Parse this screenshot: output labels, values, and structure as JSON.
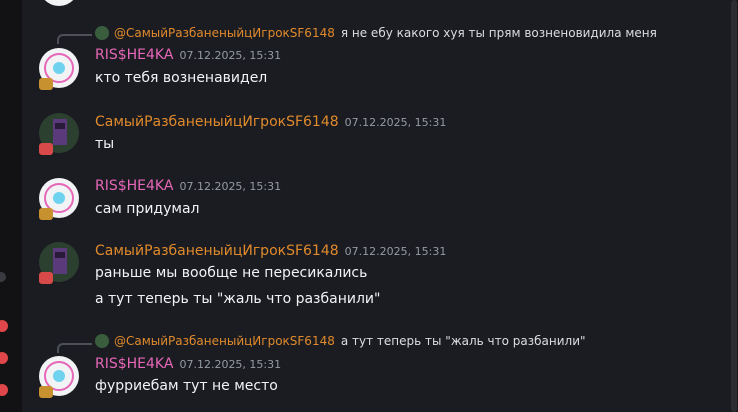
{
  "accent": {
    "pink": "#e667b8",
    "orange": "#e08a2c",
    "rail_badge": "#e0464a"
  },
  "messages": [
    {
      "reply_to": {
        "author": "@СамыйРазбаненыйцИгрокSF6148",
        "text": "я не ебу какого хуя ты прям возненовидила меня"
      },
      "author": "RIS$HE4KA",
      "timestamp": "07.12.2025, 15:31",
      "lines": [
        "кто тебя возненавидел"
      ]
    },
    {
      "author": "СамыйРазбаненыйцИгрокSF6148",
      "timestamp": "07.12.2025, 15:31",
      "lines": [
        "ты"
      ]
    },
    {
      "author": "RIS$HE4KA",
      "timestamp": "07.12.2025, 15:31",
      "lines": [
        "сам придумал"
      ]
    },
    {
      "author": "СамыйРазбаненыйцИгрокSF6148",
      "timestamp": "07.12.2025, 15:31",
      "lines": [
        "раньше мы вообще не пересикались",
        "а тут теперь ты \"жаль что разбанили\""
      ]
    },
    {
      "reply_to": {
        "author": "@СамыйРазбаненыйцИгрокSF6148",
        "text": "а тут теперь ты \"жаль что разбанили\""
      },
      "author": "RIS$HE4KA",
      "timestamp": "07.12.2025, 15:31",
      "lines": [
        "фурриебам тут не место"
      ]
    }
  ]
}
